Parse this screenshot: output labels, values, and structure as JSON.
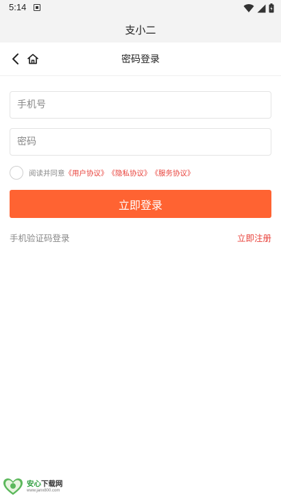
{
  "status_bar": {
    "time": "5:14",
    "icons": [
      "notification-icon",
      "wifi-icon",
      "signal-icon",
      "battery-icon"
    ]
  },
  "app": {
    "title": "支小二"
  },
  "nav": {
    "title": "密码登录",
    "back_icon": "chevron-left-icon",
    "home_icon": "home-icon"
  },
  "form": {
    "phone": {
      "placeholder": "手机号",
      "value": ""
    },
    "password": {
      "placeholder": "密码",
      "value": ""
    },
    "agreement": {
      "checked": false,
      "prefix": "阅读并同意",
      "links": [
        "《用户协议》",
        "《隐私协议》",
        "《服务协议》"
      ]
    },
    "submit_label": "立即登录"
  },
  "links": {
    "sms_login": "手机验证码登录",
    "register": "立即注册"
  },
  "watermark": {
    "title_green": "安心",
    "title_dark": "下载网",
    "url": "www.janx800.com"
  },
  "colors": {
    "accent": "#ff6332",
    "link_red": "#e8413a",
    "header_bg": "#f3f3f3",
    "placeholder": "#888888"
  }
}
